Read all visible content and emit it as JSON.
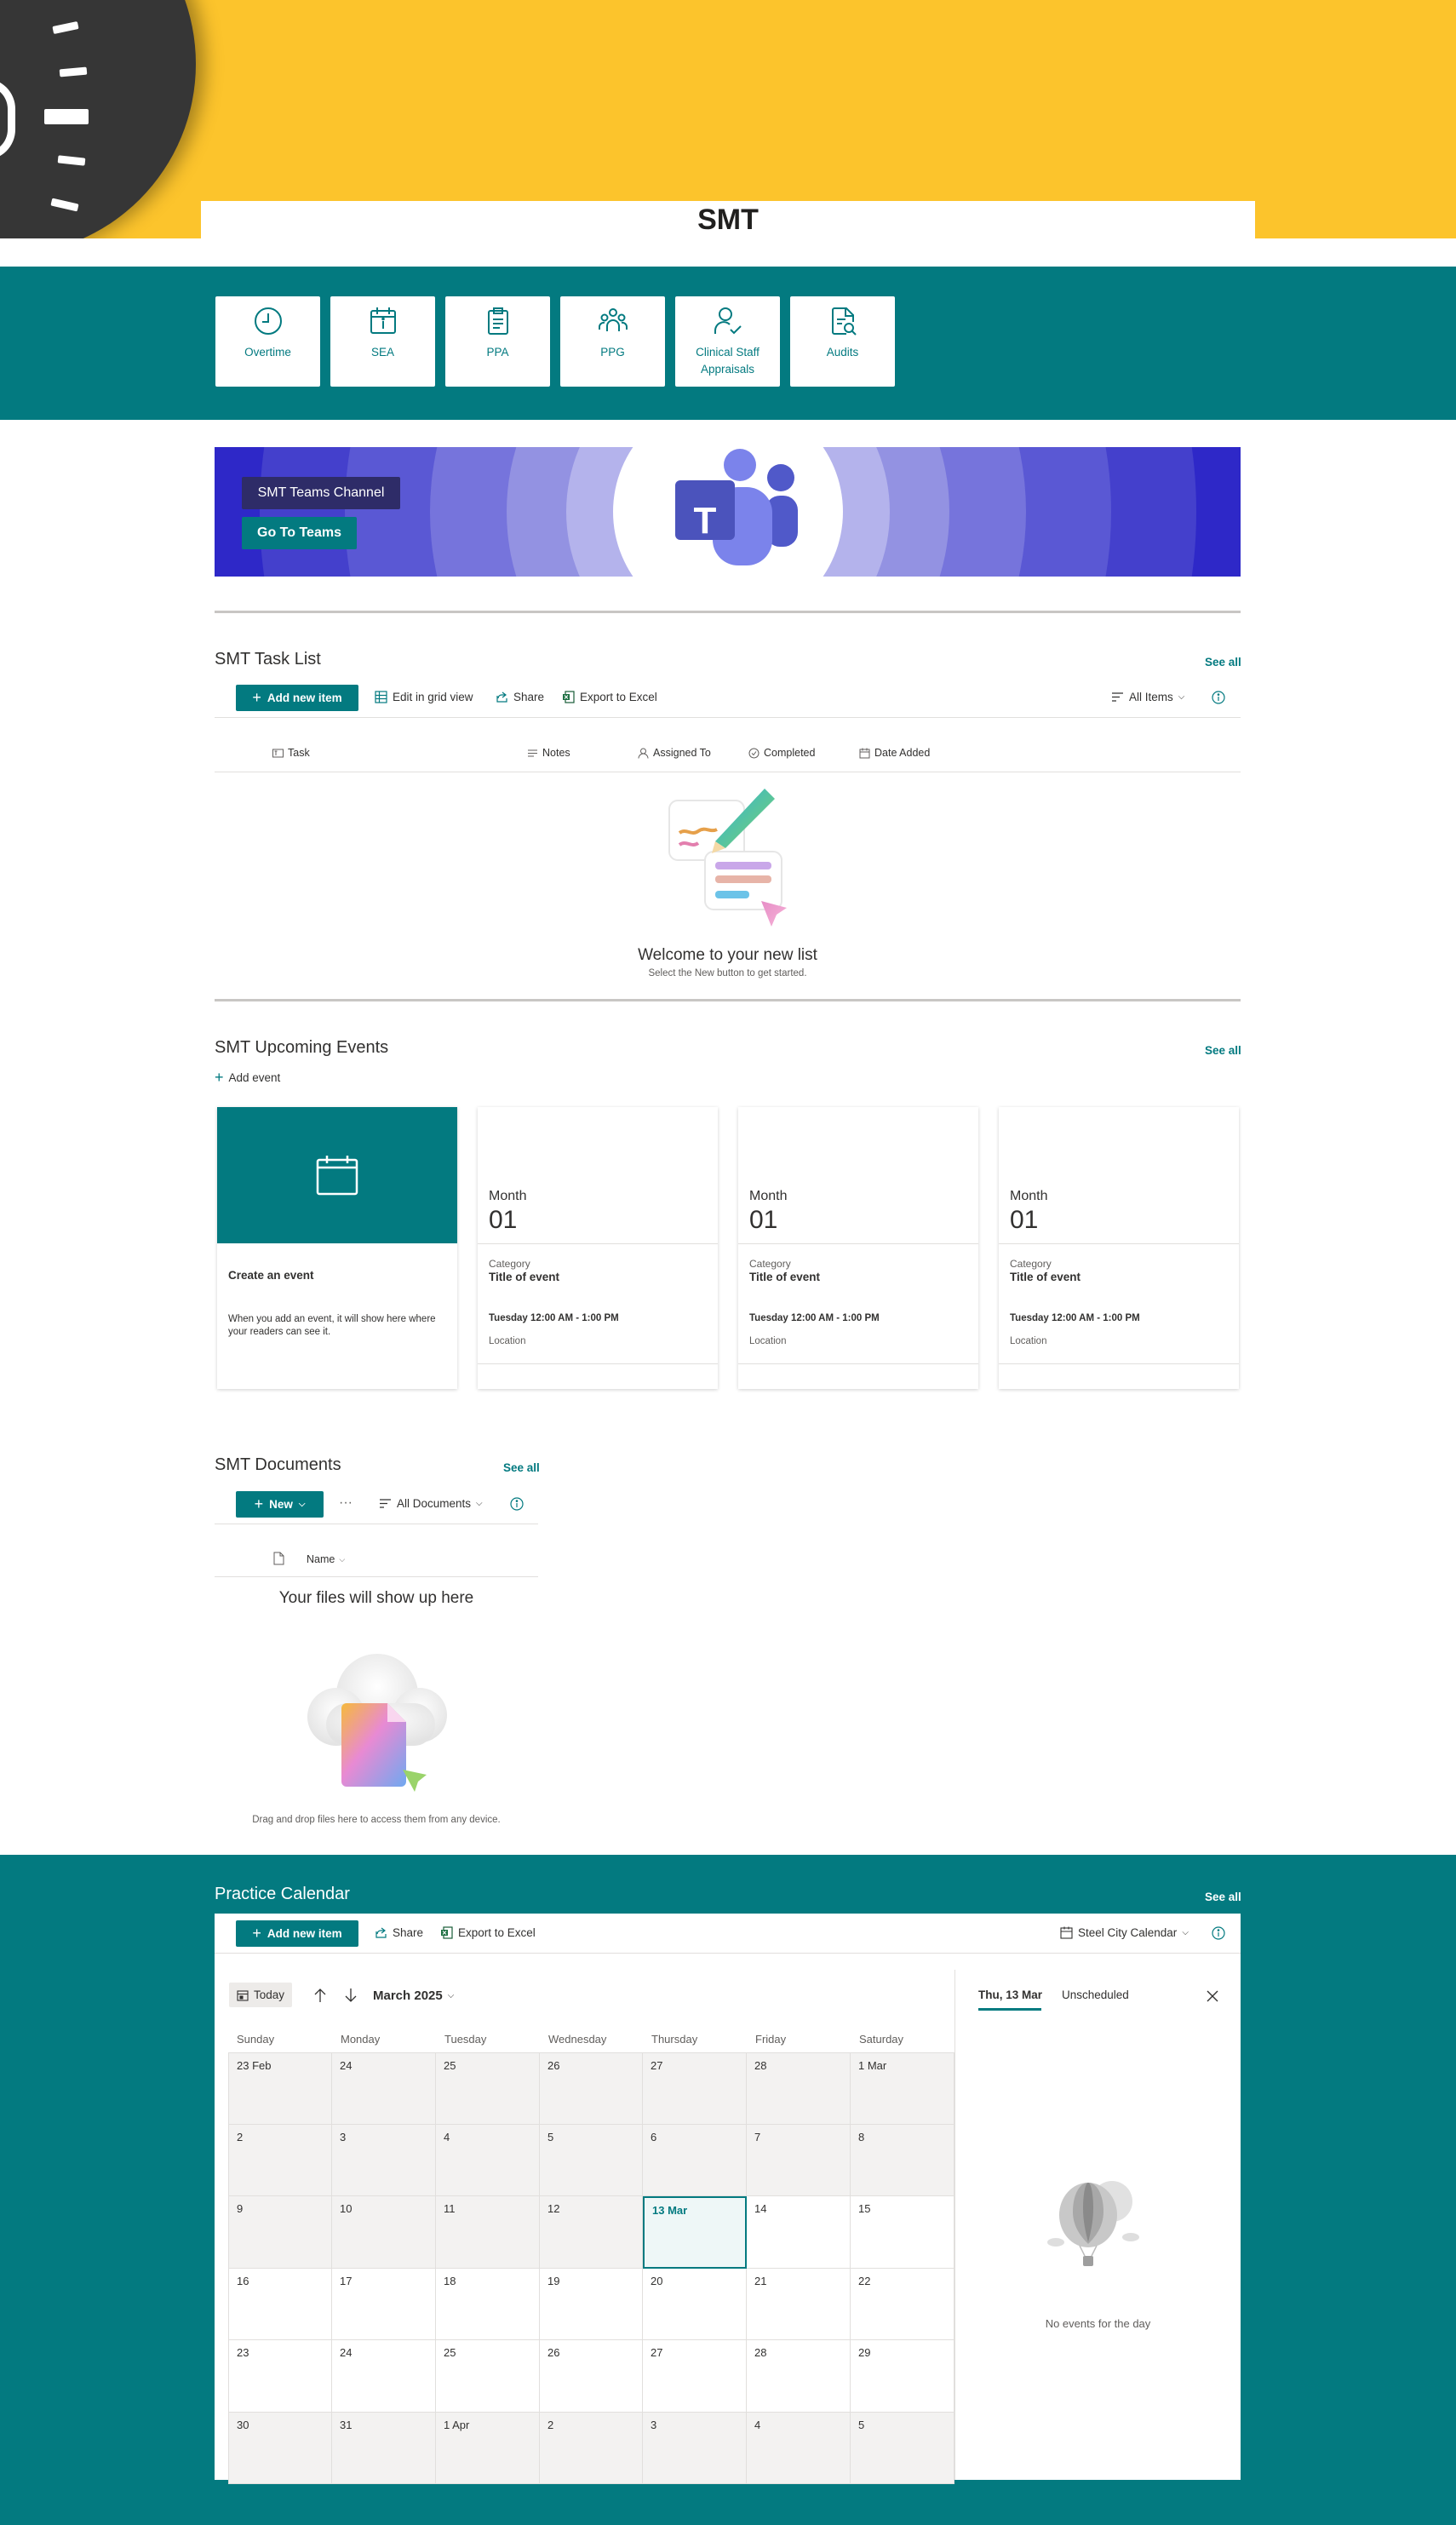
{
  "header": {
    "title": "SMT"
  },
  "quick_links": [
    {
      "label": "Overtime",
      "icon": "clock-icon"
    },
    {
      "label": "SEA",
      "icon": "calendar-info-icon"
    },
    {
      "label": "PPA",
      "icon": "clipboard-icon"
    },
    {
      "label": "PPG",
      "icon": "people-group-icon"
    },
    {
      "label": "Clinical Staff Appraisals",
      "icon": "person-check-icon"
    },
    {
      "label": "Audits",
      "icon": "document-search-icon"
    }
  ],
  "teams_banner": {
    "label": "SMT Teams Channel",
    "button": "Go To Teams",
    "logo_letter": "T"
  },
  "task_list": {
    "title": "SMT Task List",
    "see_all": "See all",
    "add_new": "Add new item",
    "edit_grid": "Edit in grid view",
    "share": "Share",
    "export": "Export to Excel",
    "view": "All Items",
    "columns": [
      "Task",
      "Notes",
      "Assigned To",
      "Completed",
      "Date Added"
    ],
    "empty_title": "Welcome to your new list",
    "empty_sub": "Select the New button to get started."
  },
  "events": {
    "title": "SMT Upcoming Events",
    "see_all": "See all",
    "add_event": "Add event",
    "create_card": {
      "title": "Create an event",
      "desc": "When you add an event, it will show here where your readers can see it."
    },
    "placeholders": [
      {
        "month": "Month",
        "day": "01",
        "category": "Category",
        "title": "Title of event",
        "time": "Tuesday 12:00 AM - 1:00 PM",
        "location": "Location"
      },
      {
        "month": "Month",
        "day": "01",
        "category": "Category",
        "title": "Title of event",
        "time": "Tuesday 12:00 AM - 1:00 PM",
        "location": "Location"
      },
      {
        "month": "Month",
        "day": "01",
        "category": "Category",
        "title": "Title of event",
        "time": "Tuesday 12:00 AM - 1:00 PM",
        "location": "Location"
      }
    ]
  },
  "documents": {
    "title": "SMT Documents",
    "see_all": "See all",
    "new_btn": "New",
    "more": "···",
    "view": "All Documents",
    "column": "Name",
    "empty_title": "Your files will show up here",
    "empty_sub": "Drag and drop files here to access them from any device."
  },
  "calendar": {
    "title": "Practice Calendar",
    "see_all": "See all",
    "add_new": "Add new item",
    "share": "Share",
    "export": "Export to Excel",
    "view": "Steel City Calendar",
    "today": "Today",
    "month_label": "March 2025",
    "day_names": [
      "Sunday",
      "Monday",
      "Tuesday",
      "Wednesday",
      "Thursday",
      "Friday",
      "Saturday"
    ],
    "weeks": [
      [
        "23 Feb",
        "24",
        "25",
        "26",
        "27",
        "28",
        "1 Mar"
      ],
      [
        "2",
        "3",
        "4",
        "5",
        "6",
        "7",
        "8"
      ],
      [
        "9",
        "10",
        "11",
        "12",
        "13 Mar",
        "14",
        "15"
      ],
      [
        "16",
        "17",
        "18",
        "19",
        "20",
        "21",
        "22"
      ],
      [
        "23",
        "24",
        "25",
        "26",
        "27",
        "28",
        "29"
      ],
      [
        "30",
        "31",
        "1 Apr",
        "2",
        "3",
        "4",
        "5"
      ]
    ],
    "selected_day": "13 Mar",
    "side_tabs": [
      "Thu, 13 Mar",
      "Unscheduled"
    ],
    "no_events": "No events for the day"
  },
  "colors": {
    "teal": "#037a80",
    "yellow": "#fcc42c",
    "teams_purple": "#4b53bc"
  }
}
